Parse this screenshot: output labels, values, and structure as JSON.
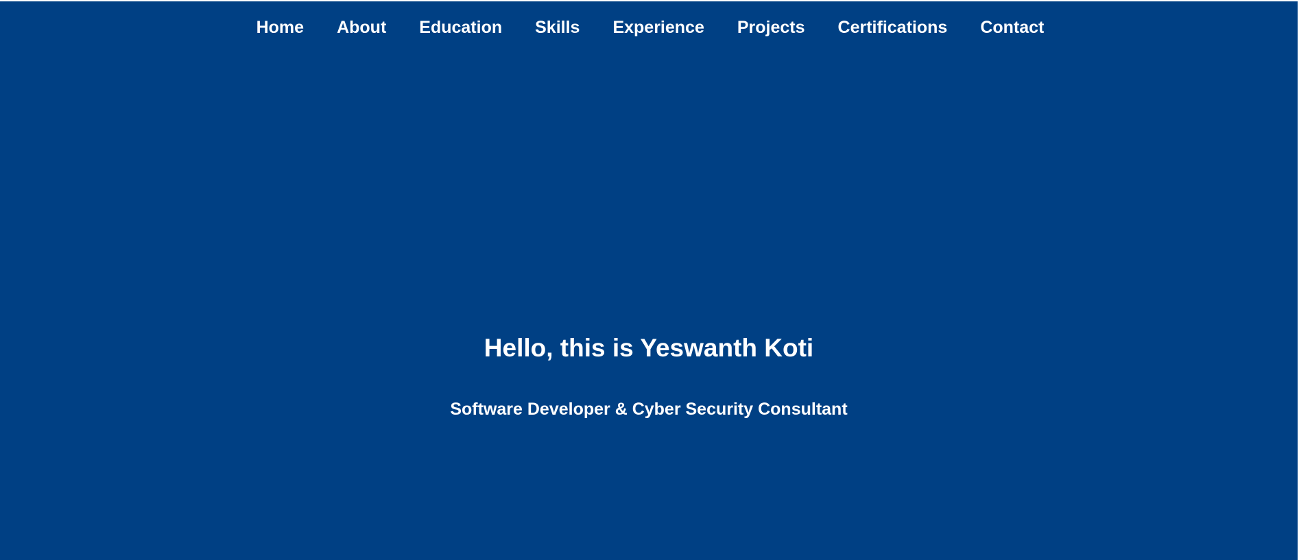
{
  "colors": {
    "background": "#004084",
    "text": "#ffffff"
  },
  "nav": {
    "items": [
      {
        "label": "Home"
      },
      {
        "label": "About"
      },
      {
        "label": "Education"
      },
      {
        "label": "Skills"
      },
      {
        "label": "Experience"
      },
      {
        "label": "Projects"
      },
      {
        "label": "Certifications"
      },
      {
        "label": "Contact"
      }
    ]
  },
  "hero": {
    "title": "Hello, this is Yeswanth Koti",
    "subtitle": "Software Developer & Cyber Security Consultant"
  }
}
